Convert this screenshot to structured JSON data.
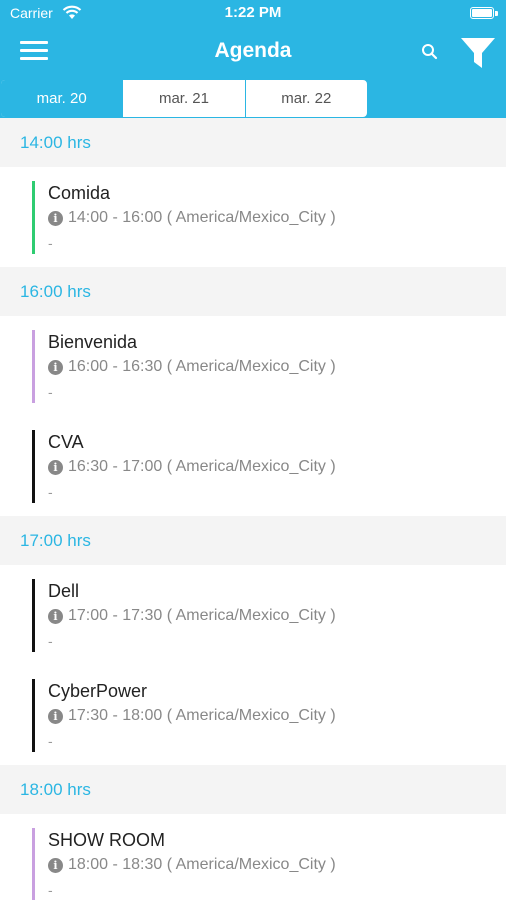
{
  "status_bar": {
    "carrier": "Carrier",
    "time": "1:22 PM"
  },
  "nav": {
    "title": "Agenda"
  },
  "icons": {
    "menu": "hamburger-icon",
    "search": "search-icon",
    "filter": "filter-icon",
    "info": "info-icon",
    "wifi": "wifi-icon",
    "battery": "battery-icon"
  },
  "colors": {
    "accent": "#2bb6e3",
    "green": "#2ecc71",
    "purple": "#c9a0e0",
    "black": "#111111"
  },
  "tabs": [
    {
      "label": "mar. 20",
      "active": true
    },
    {
      "label": "mar. 21",
      "active": false
    },
    {
      "label": "mar. 22",
      "active": false
    }
  ],
  "sections": [
    {
      "header": "14:00 hrs",
      "events": [
        {
          "title": "Comida",
          "time": "14:00 - 16:00 ( America/Mexico_City )",
          "desc": "-",
          "color": "#2ecc71"
        }
      ]
    },
    {
      "header": "16:00 hrs",
      "events": [
        {
          "title": "Bienvenida",
          "time": "16:00 - 16:30 ( America/Mexico_City )",
          "desc": "-",
          "color": "#c9a0e0"
        },
        {
          "title": "CVA",
          "time": "16:30 - 17:00 ( America/Mexico_City )",
          "desc": "-",
          "color": "#111111"
        }
      ]
    },
    {
      "header": "17:00 hrs",
      "events": [
        {
          "title": "Dell",
          "time": "17:00 - 17:30 ( America/Mexico_City )",
          "desc": "-",
          "color": "#111111"
        },
        {
          "title": "CyberPower",
          "time": "17:30 - 18:00 ( America/Mexico_City )",
          "desc": "-",
          "color": "#111111"
        }
      ]
    },
    {
      "header": "18:00 hrs",
      "events": [
        {
          "title": "SHOW ROOM",
          "time": "18:00 - 18:30 ( America/Mexico_City )",
          "desc": "-",
          "color": "#c9a0e0"
        }
      ]
    }
  ]
}
